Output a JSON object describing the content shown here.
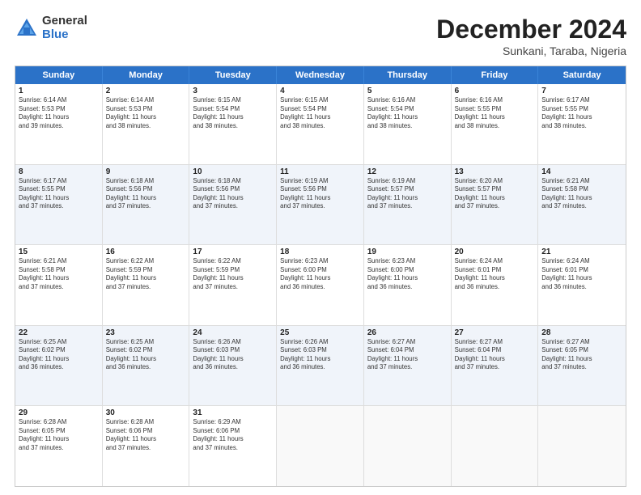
{
  "logo": {
    "general": "General",
    "blue": "Blue"
  },
  "header": {
    "month": "December 2024",
    "location": "Sunkani, Taraba, Nigeria"
  },
  "days": [
    "Sunday",
    "Monday",
    "Tuesday",
    "Wednesday",
    "Thursday",
    "Friday",
    "Saturday"
  ],
  "rows": [
    [
      {
        "num": "1",
        "lines": [
          "Sunrise: 6:14 AM",
          "Sunset: 5:53 PM",
          "Daylight: 11 hours",
          "and 39 minutes."
        ]
      },
      {
        "num": "2",
        "lines": [
          "Sunrise: 6:14 AM",
          "Sunset: 5:53 PM",
          "Daylight: 11 hours",
          "and 38 minutes."
        ]
      },
      {
        "num": "3",
        "lines": [
          "Sunrise: 6:15 AM",
          "Sunset: 5:54 PM",
          "Daylight: 11 hours",
          "and 38 minutes."
        ]
      },
      {
        "num": "4",
        "lines": [
          "Sunrise: 6:15 AM",
          "Sunset: 5:54 PM",
          "Daylight: 11 hours",
          "and 38 minutes."
        ]
      },
      {
        "num": "5",
        "lines": [
          "Sunrise: 6:16 AM",
          "Sunset: 5:54 PM",
          "Daylight: 11 hours",
          "and 38 minutes."
        ]
      },
      {
        "num": "6",
        "lines": [
          "Sunrise: 6:16 AM",
          "Sunset: 5:55 PM",
          "Daylight: 11 hours",
          "and 38 minutes."
        ]
      },
      {
        "num": "7",
        "lines": [
          "Sunrise: 6:17 AM",
          "Sunset: 5:55 PM",
          "Daylight: 11 hours",
          "and 38 minutes."
        ]
      }
    ],
    [
      {
        "num": "8",
        "lines": [
          "Sunrise: 6:17 AM",
          "Sunset: 5:55 PM",
          "Daylight: 11 hours",
          "and 37 minutes."
        ]
      },
      {
        "num": "9",
        "lines": [
          "Sunrise: 6:18 AM",
          "Sunset: 5:56 PM",
          "Daylight: 11 hours",
          "and 37 minutes."
        ]
      },
      {
        "num": "10",
        "lines": [
          "Sunrise: 6:18 AM",
          "Sunset: 5:56 PM",
          "Daylight: 11 hours",
          "and 37 minutes."
        ]
      },
      {
        "num": "11",
        "lines": [
          "Sunrise: 6:19 AM",
          "Sunset: 5:56 PM",
          "Daylight: 11 hours",
          "and 37 minutes."
        ]
      },
      {
        "num": "12",
        "lines": [
          "Sunrise: 6:19 AM",
          "Sunset: 5:57 PM",
          "Daylight: 11 hours",
          "and 37 minutes."
        ]
      },
      {
        "num": "13",
        "lines": [
          "Sunrise: 6:20 AM",
          "Sunset: 5:57 PM",
          "Daylight: 11 hours",
          "and 37 minutes."
        ]
      },
      {
        "num": "14",
        "lines": [
          "Sunrise: 6:21 AM",
          "Sunset: 5:58 PM",
          "Daylight: 11 hours",
          "and 37 minutes."
        ]
      }
    ],
    [
      {
        "num": "15",
        "lines": [
          "Sunrise: 6:21 AM",
          "Sunset: 5:58 PM",
          "Daylight: 11 hours",
          "and 37 minutes."
        ]
      },
      {
        "num": "16",
        "lines": [
          "Sunrise: 6:22 AM",
          "Sunset: 5:59 PM",
          "Daylight: 11 hours",
          "and 37 minutes."
        ]
      },
      {
        "num": "17",
        "lines": [
          "Sunrise: 6:22 AM",
          "Sunset: 5:59 PM",
          "Daylight: 11 hours",
          "and 37 minutes."
        ]
      },
      {
        "num": "18",
        "lines": [
          "Sunrise: 6:23 AM",
          "Sunset: 6:00 PM",
          "Daylight: 11 hours",
          "and 36 minutes."
        ]
      },
      {
        "num": "19",
        "lines": [
          "Sunrise: 6:23 AM",
          "Sunset: 6:00 PM",
          "Daylight: 11 hours",
          "and 36 minutes."
        ]
      },
      {
        "num": "20",
        "lines": [
          "Sunrise: 6:24 AM",
          "Sunset: 6:01 PM",
          "Daylight: 11 hours",
          "and 36 minutes."
        ]
      },
      {
        "num": "21",
        "lines": [
          "Sunrise: 6:24 AM",
          "Sunset: 6:01 PM",
          "Daylight: 11 hours",
          "and 36 minutes."
        ]
      }
    ],
    [
      {
        "num": "22",
        "lines": [
          "Sunrise: 6:25 AM",
          "Sunset: 6:02 PM",
          "Daylight: 11 hours",
          "and 36 minutes."
        ]
      },
      {
        "num": "23",
        "lines": [
          "Sunrise: 6:25 AM",
          "Sunset: 6:02 PM",
          "Daylight: 11 hours",
          "and 36 minutes."
        ]
      },
      {
        "num": "24",
        "lines": [
          "Sunrise: 6:26 AM",
          "Sunset: 6:03 PM",
          "Daylight: 11 hours",
          "and 36 minutes."
        ]
      },
      {
        "num": "25",
        "lines": [
          "Sunrise: 6:26 AM",
          "Sunset: 6:03 PM",
          "Daylight: 11 hours",
          "and 36 minutes."
        ]
      },
      {
        "num": "26",
        "lines": [
          "Sunrise: 6:27 AM",
          "Sunset: 6:04 PM",
          "Daylight: 11 hours",
          "and 37 minutes."
        ]
      },
      {
        "num": "27",
        "lines": [
          "Sunrise: 6:27 AM",
          "Sunset: 6:04 PM",
          "Daylight: 11 hours",
          "and 37 minutes."
        ]
      },
      {
        "num": "28",
        "lines": [
          "Sunrise: 6:27 AM",
          "Sunset: 6:05 PM",
          "Daylight: 11 hours",
          "and 37 minutes."
        ]
      }
    ],
    [
      {
        "num": "29",
        "lines": [
          "Sunrise: 6:28 AM",
          "Sunset: 6:05 PM",
          "Daylight: 11 hours",
          "and 37 minutes."
        ]
      },
      {
        "num": "30",
        "lines": [
          "Sunrise: 6:28 AM",
          "Sunset: 6:06 PM",
          "Daylight: 11 hours",
          "and 37 minutes."
        ]
      },
      {
        "num": "31",
        "lines": [
          "Sunrise: 6:29 AM",
          "Sunset: 6:06 PM",
          "Daylight: 11 hours",
          "and 37 minutes."
        ]
      },
      {
        "num": "",
        "lines": []
      },
      {
        "num": "",
        "lines": []
      },
      {
        "num": "",
        "lines": []
      },
      {
        "num": "",
        "lines": []
      }
    ]
  ]
}
